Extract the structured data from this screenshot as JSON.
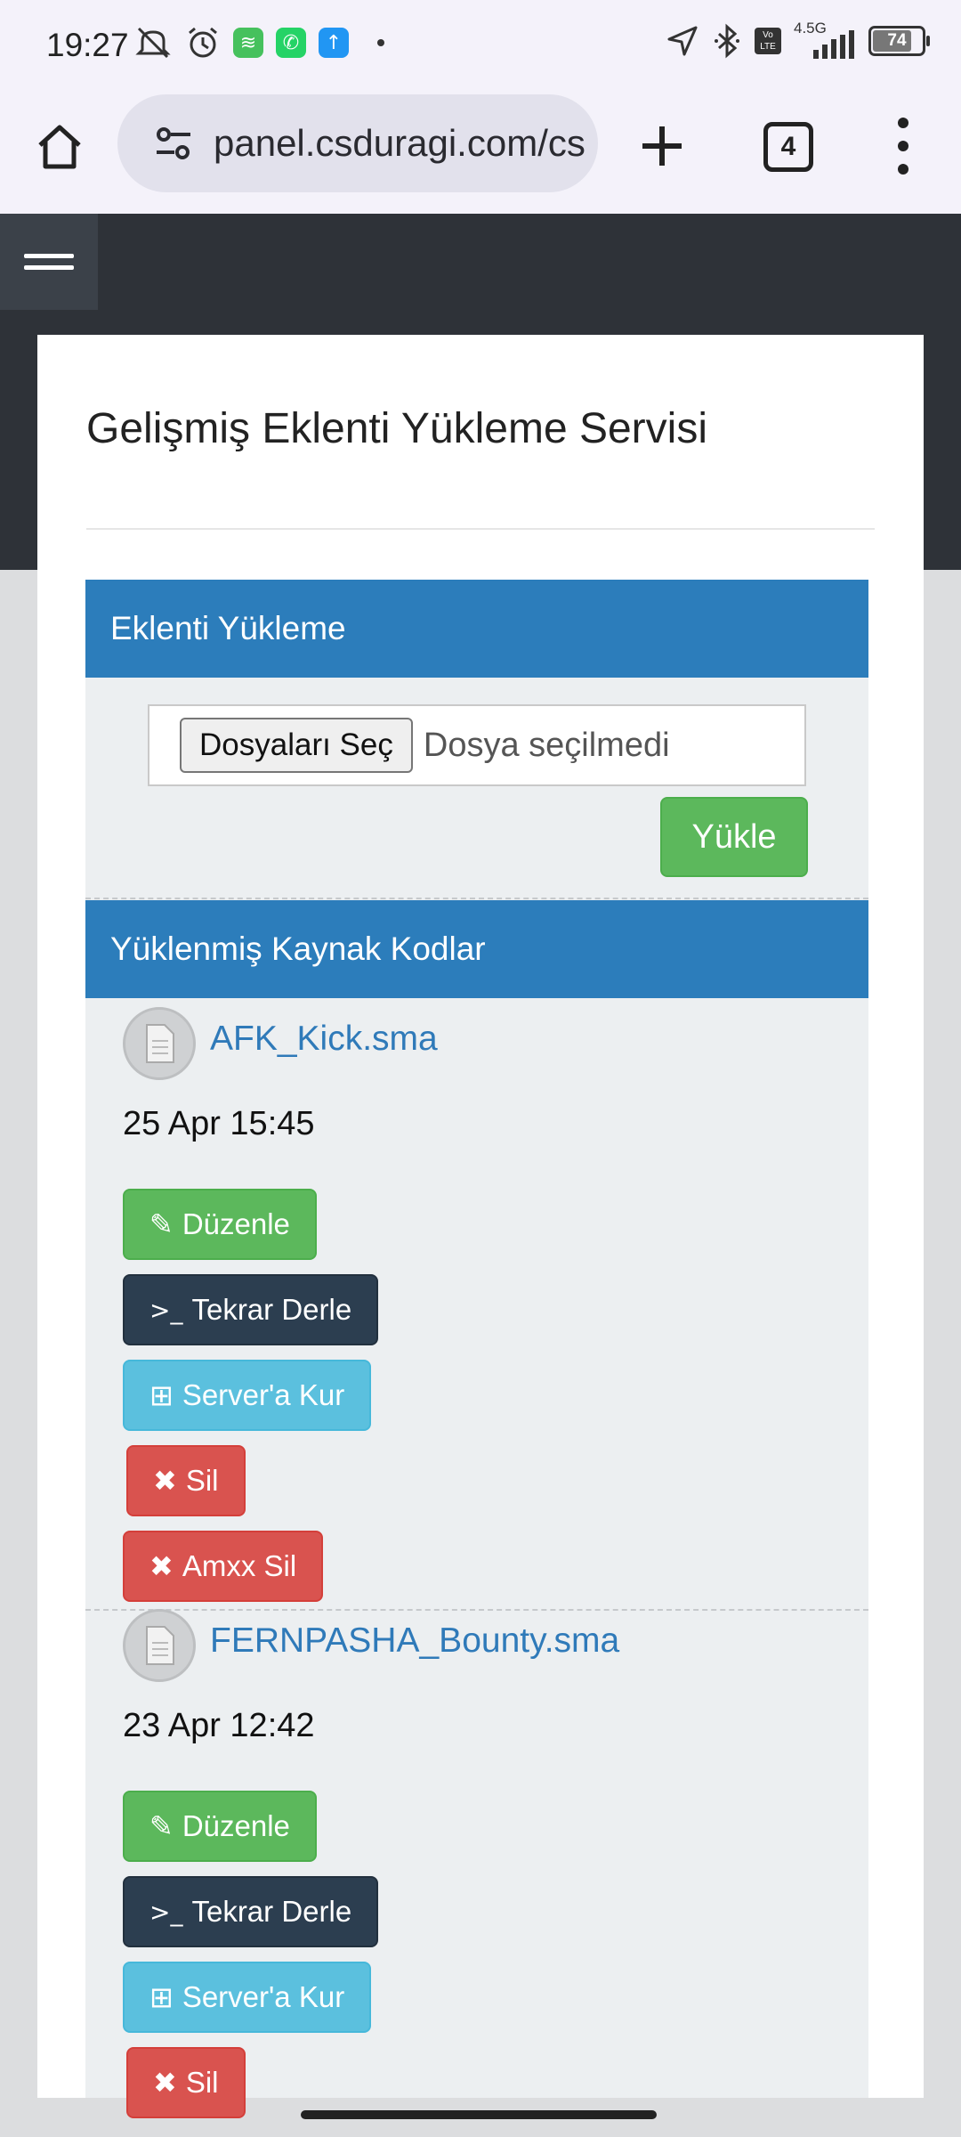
{
  "status_bar": {
    "time": "19:27",
    "network": "4.5G",
    "volte": "Vo LTE",
    "battery": "74",
    "battery_level": 0.74,
    "left_icons": [
      "mute-icon",
      "alarm-icon",
      "layers-app-icon",
      "whatsapp-icon",
      "upload-app-icon"
    ],
    "right_icons": [
      "location-icon",
      "bluetooth-icon",
      "volte-icon",
      "signal-icon",
      "battery-icon"
    ]
  },
  "browser": {
    "url": "panel.csduragi.com/cs",
    "tab_count": "4",
    "icons": [
      "home-icon",
      "site-settings-icon",
      "new-tab-icon",
      "tabs-icon",
      "menu-icon"
    ]
  },
  "page": {
    "title": "Gelişmiş Eklenti Yükleme Servisi",
    "upload_panel": {
      "title": "Eklenti Yükleme",
      "file_button": "Dosyaları Seç",
      "file_status": "Dosya seçilmedi",
      "upload_button": "Yükle"
    },
    "files_panel": {
      "title": "Yüklenmiş Kaynak Kodlar",
      "files": [
        {
          "name": "AFK_Kick.sma",
          "date": "25 Apr 15:45",
          "buttons": {
            "edit": "Düzenle",
            "compile": "Tekrar Derle",
            "install": "Server'a Kur",
            "delete": "Sil",
            "delete_amxx": "Amxx Sil"
          }
        },
        {
          "name": "FERNPASHA_Bounty.sma",
          "date": "23 Apr 12:42",
          "buttons": {
            "edit": "Düzenle",
            "compile": "Tekrar Derle",
            "install": "Server'a Kur",
            "delete": "Sil"
          }
        }
      ]
    }
  },
  "colors": {
    "header_dark": "#2e3238",
    "panel_blue": "#2c7dbb",
    "success": "#5cb85c",
    "dark": "#2c3e50",
    "info": "#5bc0de",
    "danger": "#d9534f",
    "link": "#2f7ab9"
  }
}
